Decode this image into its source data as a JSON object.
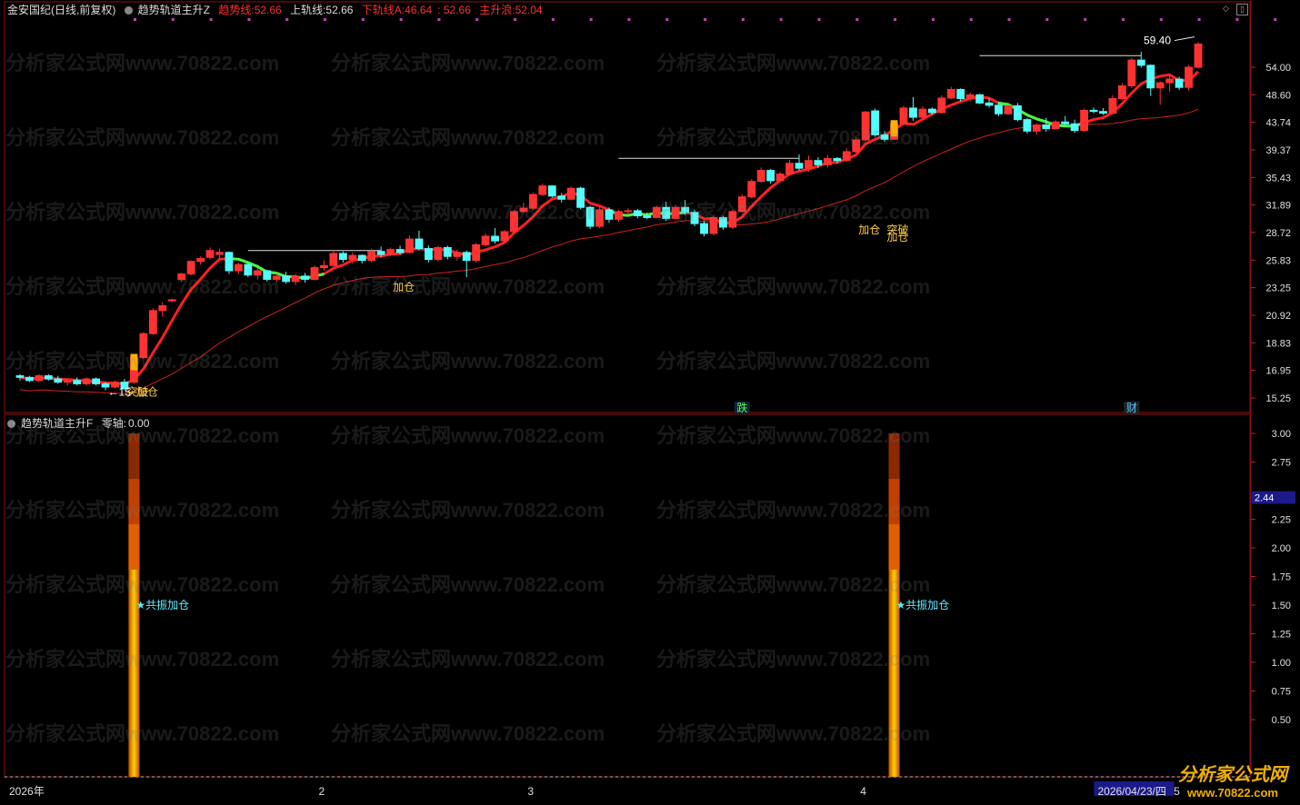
{
  "main_header": {
    "stock": "金安国纪(日线,前复权)",
    "indicator": "趋势轨道主升Z",
    "trend_label": "趋势线:",
    "trend_val": "52.66",
    "upper_label": "上轨线:",
    "upper_val": "52.66",
    "lowerA_label": "下轨线A:",
    "lowerA_val": "46.64",
    "lower2_val": ": 52.66",
    "rise_label": "主升浪:",
    "rise_val": "52.04"
  },
  "sub_header": {
    "indicator": "趋势轨道主升F",
    "zero_label": "零轴:",
    "zero_val": "0.00"
  },
  "watermark": "分析家公式网www.70822.com",
  "logo": {
    "line1": "分析家公式网",
    "line2": "www.70822.com"
  },
  "colors": {
    "up": "#ff3232",
    "down": "#54fcfc",
    "trend": "#ff2020",
    "lower": "#d02020",
    "green": "#40ff40"
  },
  "chart_data": [
    {
      "type": "candlestick",
      "y_ticks": [
        "54.00",
        "48.60",
        "43.74",
        "39.37",
        "35.43",
        "31.89",
        "28.72",
        "25.83",
        "23.25",
        "20.92",
        "18.83",
        "16.95",
        "15.25"
      ],
      "ylim": [
        15.25,
        59.4
      ],
      "log_scale": true,
      "max_label": "59.40",
      "candles": [
        [
          16.6,
          16.7,
          16.3,
          16.5
        ],
        [
          16.5,
          16.6,
          16.2,
          16.3
        ],
        [
          16.3,
          16.7,
          16.2,
          16.6
        ],
        [
          16.6,
          16.7,
          16.3,
          16.4
        ],
        [
          16.4,
          16.6,
          16.1,
          16.2
        ],
        [
          16.2,
          16.4,
          16.0,
          16.3
        ],
        [
          16.3,
          16.5,
          16.0,
          16.1
        ],
        [
          16.1,
          16.5,
          16.0,
          16.4
        ],
        [
          16.4,
          16.5,
          16.0,
          16.1
        ],
        [
          16.1,
          16.2,
          15.7,
          15.9
        ],
        [
          15.9,
          16.3,
          15.8,
          16.2
        ],
        [
          16.2,
          16.4,
          15.7,
          15.8
        ],
        [
          16.2,
          17.9,
          16.1,
          17.8
        ],
        [
          17.8,
          19.6,
          17.7,
          19.5
        ],
        [
          19.5,
          21.5,
          19.4,
          21.3
        ],
        [
          21.3,
          22.0,
          20.8,
          21.7
        ],
        [
          22.1,
          22.3,
          22.0,
          22.2
        ],
        [
          24.0,
          24.6,
          23.8,
          24.5
        ],
        [
          24.5,
          25.8,
          24.4,
          25.7
        ],
        [
          25.7,
          26.2,
          25.4,
          26.0
        ],
        [
          26.1,
          27.1,
          25.9,
          26.8
        ],
        [
          26.4,
          27.0,
          25.8,
          26.6
        ],
        [
          26.6,
          26.7,
          24.5,
          24.8
        ],
        [
          24.8,
          25.6,
          24.5,
          25.4
        ],
        [
          25.4,
          25.5,
          24.2,
          24.4
        ],
        [
          24.4,
          25.1,
          24.0,
          24.8
        ],
        [
          24.8,
          24.9,
          23.8,
          24.0
        ],
        [
          24.0,
          24.6,
          23.7,
          24.3
        ],
        [
          24.3,
          24.7,
          23.6,
          23.8
        ],
        [
          23.8,
          24.5,
          23.5,
          24.3
        ],
        [
          24.3,
          24.6,
          23.7,
          24.0
        ],
        [
          24.0,
          25.3,
          23.9,
          25.1
        ],
        [
          25.1,
          25.8,
          24.8,
          25.3
        ],
        [
          25.3,
          26.8,
          25.2,
          26.5
        ],
        [
          26.5,
          26.7,
          25.6,
          25.9
        ],
        [
          25.9,
          26.6,
          25.5,
          26.3
        ],
        [
          26.3,
          26.4,
          25.5,
          25.8
        ],
        [
          25.8,
          27.0,
          25.6,
          26.7
        ],
        [
          26.7,
          27.2,
          26.1,
          26.4
        ],
        [
          26.4,
          27.1,
          26.2,
          26.9
        ],
        [
          26.9,
          27.3,
          26.4,
          26.6
        ],
        [
          26.6,
          28.4,
          26.5,
          28.0
        ],
        [
          28.0,
          28.9,
          26.8,
          27.0
        ],
        [
          27.0,
          27.3,
          25.6,
          25.9
        ],
        [
          25.9,
          27.3,
          25.7,
          27.1
        ],
        [
          27.1,
          27.3,
          25.9,
          26.2
        ],
        [
          26.2,
          26.9,
          25.8,
          26.6
        ],
        [
          26.6,
          26.8,
          24.2,
          25.8
        ],
        [
          25.8,
          27.6,
          25.6,
          27.4
        ],
        [
          27.4,
          28.6,
          27.2,
          28.3
        ],
        [
          28.3,
          29.2,
          27.5,
          27.8
        ],
        [
          27.8,
          29.0,
          27.6,
          28.8
        ],
        [
          28.8,
          31.3,
          28.6,
          31.1
        ],
        [
          31.1,
          32.2,
          30.9,
          31.5
        ],
        [
          31.5,
          33.4,
          31.3,
          33.2
        ],
        [
          33.2,
          34.6,
          33.0,
          34.3
        ],
        [
          34.3,
          34.4,
          32.8,
          33.0
        ],
        [
          33.0,
          33.4,
          32.2,
          32.6
        ],
        [
          32.6,
          34.2,
          32.5,
          34.0
        ],
        [
          34.0,
          34.2,
          31.4,
          31.6
        ],
        [
          31.6,
          31.8,
          29.1,
          29.4
        ],
        [
          29.4,
          31.7,
          29.2,
          31.3
        ],
        [
          31.3,
          31.6,
          29.8,
          30.2
        ],
        [
          30.2,
          31.3,
          29.9,
          31.1
        ],
        [
          31.1,
          31.5,
          30.7,
          31.2
        ],
        [
          31.2,
          31.4,
          30.3,
          30.6
        ],
        [
          30.6,
          31.0,
          30.2,
          30.4
        ],
        [
          30.4,
          31.8,
          30.3,
          31.6
        ],
        [
          31.6,
          32.3,
          30.0,
          30.3
        ],
        [
          30.3,
          31.9,
          30.2,
          31.6
        ],
        [
          31.6,
          32.5,
          30.7,
          31.0
        ],
        [
          31.0,
          31.3,
          29.4,
          29.7
        ],
        [
          29.7,
          30.0,
          28.3,
          28.6
        ],
        [
          28.6,
          30.7,
          28.4,
          30.4
        ],
        [
          30.4,
          30.6,
          29.0,
          29.3
        ],
        [
          29.3,
          31.3,
          29.1,
          31.1
        ],
        [
          31.1,
          33.2,
          31.0,
          32.9
        ],
        [
          32.9,
          35.2,
          32.7,
          34.9
        ],
        [
          34.9,
          36.8,
          34.7,
          36.4
        ],
        [
          36.4,
          36.6,
          34.6,
          35.0
        ],
        [
          35.0,
          36.2,
          34.8,
          35.9
        ],
        [
          35.9,
          37.9,
          35.7,
          37.4
        ],
        [
          37.4,
          38.7,
          36.4,
          36.7
        ],
        [
          36.7,
          38.5,
          36.2,
          37.8
        ],
        [
          37.8,
          38.3,
          36.7,
          37.2
        ],
        [
          37.2,
          38.6,
          36.8,
          38.1
        ],
        [
          38.1,
          38.3,
          37.4,
          37.8
        ],
        [
          37.8,
          39.6,
          37.6,
          39.1
        ],
        [
          39.1,
          41.3,
          38.9,
          40.9
        ],
        [
          40.9,
          45.7,
          40.7,
          45.5
        ],
        [
          45.7,
          46.1,
          41.4,
          41.7
        ],
        [
          41.7,
          42.3,
          40.6,
          41.0
        ],
        [
          41.0,
          43.8,
          40.9,
          43.5
        ],
        [
          43.5,
          46.6,
          43.3,
          46.2
        ],
        [
          46.2,
          48.2,
          44.0,
          44.6
        ],
        [
          44.6,
          46.5,
          44.2,
          46.0
        ],
        [
          46.0,
          46.3,
          45.0,
          45.4
        ],
        [
          45.4,
          48.5,
          45.2,
          48.0
        ],
        [
          48.0,
          50.1,
          47.8,
          49.6
        ],
        [
          49.6,
          49.8,
          47.4,
          47.9
        ],
        [
          47.9,
          49.0,
          47.3,
          48.6
        ],
        [
          48.6,
          48.8,
          46.9,
          47.1
        ],
        [
          47.1,
          47.9,
          46.3,
          46.7
        ],
        [
          46.7,
          47.3,
          44.8,
          45.2
        ],
        [
          45.2,
          46.8,
          45.0,
          46.6
        ],
        [
          46.6,
          47.1,
          43.9,
          44.2
        ],
        [
          44.2,
          44.5,
          41.9,
          42.3
        ],
        [
          42.3,
          43.6,
          41.7,
          43.3
        ],
        [
          43.3,
          44.5,
          42.2,
          42.7
        ],
        [
          42.7,
          44.1,
          42.5,
          43.8
        ],
        [
          43.8,
          44.8,
          43.2,
          43.5
        ],
        [
          43.5,
          44.2,
          42.0,
          42.4
        ],
        [
          42.4,
          46.1,
          42.2,
          45.8
        ],
        [
          45.8,
          46.3,
          45.3,
          45.6
        ],
        [
          45.6,
          46.2,
          45.0,
          45.3
        ],
        [
          45.3,
          48.5,
          45.1,
          47.9
        ],
        [
          47.9,
          50.8,
          47.6,
          50.3
        ],
        [
          50.3,
          55.9,
          49.9,
          55.5
        ],
        [
          55.5,
          57.3,
          53.9,
          54.4
        ],
        [
          54.4,
          54.6,
          48.4,
          49.9
        ],
        [
          49.9,
          51.2,
          46.8,
          50.9
        ],
        [
          50.9,
          52.4,
          49.2,
          51.6
        ],
        [
          51.6,
          52.1,
          49.5,
          50.0
        ],
        [
          50.0,
          54.5,
          49.4,
          54.0
        ],
        [
          54.0,
          59.4,
          53.7,
          59.0
        ]
      ],
      "annotations": [
        {
          "text": "突破",
          "idx": 12,
          "price": 15.6
        },
        {
          "text": "加仓",
          "idx": 13,
          "price": 15.6
        },
        {
          "text": "←15",
          "idx": 10,
          "price": 15.6
        },
        {
          "text": "加仓",
          "idx": 40,
          "price": 23.3
        },
        {
          "text": "加仓",
          "idx": 89,
          "price": 29.0
        },
        {
          "text": "突破",
          "idx": 92,
          "price": 29.0
        },
        {
          "text": "加仓",
          "idx": 92,
          "price": 28.2
        },
        {
          "text": "加仓",
          "idx": 137,
          "price": 42.0
        }
      ],
      "event_tags": [
        {
          "text": "跌",
          "idx": 76
        },
        {
          "text": "财",
          "idx": 117
        },
        {
          "text": "涨榜",
          "idx": 147
        }
      ]
    },
    {
      "type": "bar",
      "y_ticks": [
        "3.00",
        "2.75",
        "2.25",
        "2.00",
        "1.75",
        "1.50",
        "1.25",
        "1.00",
        "0.75",
        "0.50"
      ],
      "ylim": [
        0,
        3.0
      ],
      "current_value": "2.44",
      "bars": [
        {
          "idx": 12,
          "value": 3.0,
          "label": "★共振加仓"
        },
        {
          "idx": 92,
          "value": 3.0,
          "label": "★共振加仓"
        }
      ],
      "x_labels": [
        {
          "text": "2026年",
          "idx": 0
        },
        {
          "text": "2",
          "idx": 32
        },
        {
          "text": "3",
          "idx": 54
        },
        {
          "text": "4",
          "idx": 89
        },
        {
          "text": "2026/04/23/四",
          "idx": 114
        },
        {
          "text": "5",
          "idx": 122
        }
      ]
    }
  ]
}
